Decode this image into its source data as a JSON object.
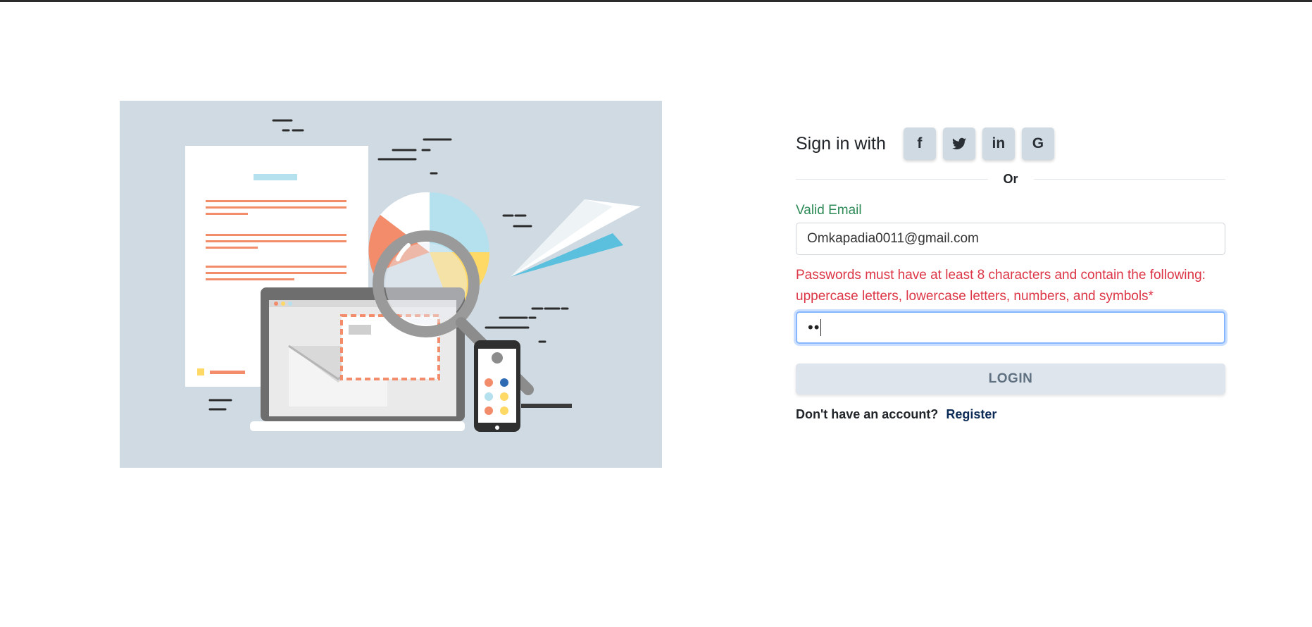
{
  "form": {
    "signin_label": "Sign in with",
    "social_buttons": [
      "f",
      "🐦",
      "in",
      "G"
    ],
    "divider_text": "Or",
    "email_valid_label": "Valid Email",
    "email_value": "Omkapadia0011@gmail.com",
    "password_error": "Passwords must have at least 8 characters and contain the following: uppercase letters, lowercase letters, numbers, and symbols*",
    "password_masked": "••",
    "login_label": "LOGIN",
    "no_account_text": "Don't have an account?",
    "register_label": "Register"
  },
  "colors": {
    "illustration_bg": "#cfdae3",
    "accent_orange": "#f28c6b",
    "accent_blue": "#5bc0de",
    "accent_yellow": "#ffd966",
    "valid_green": "#2e8b57",
    "error_red": "#dc3545"
  }
}
